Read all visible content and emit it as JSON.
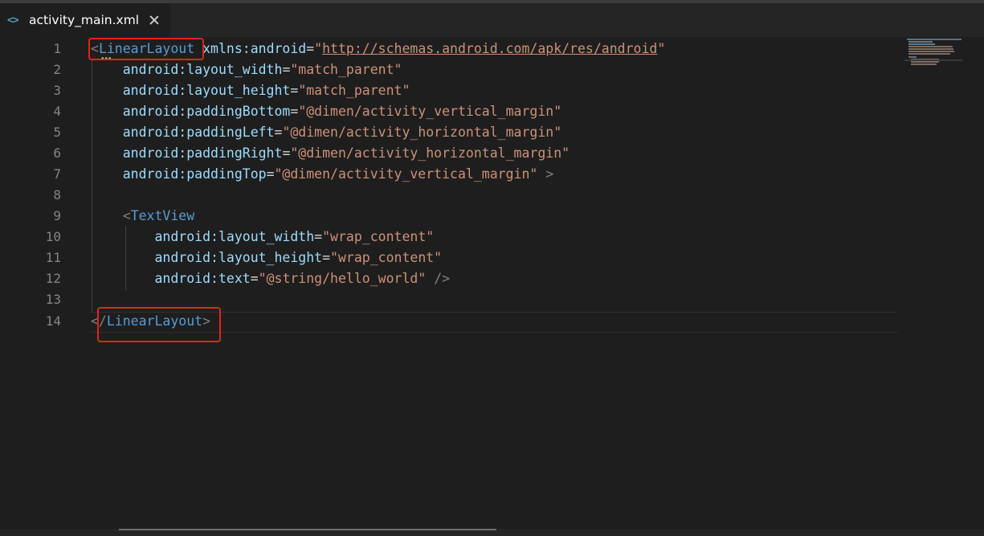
{
  "tab": {
    "icon": "<>",
    "icon_name": "xml-file-icon",
    "title": "activity_main.xml",
    "close_icon": "close-icon"
  },
  "line_numbers": [
    "1",
    "2",
    "3",
    "4",
    "5",
    "6",
    "7",
    "8",
    "9",
    "10",
    "11",
    "12",
    "13",
    "14"
  ],
  "code": {
    "l1": {
      "lt": "<",
      "tag": "LinearLayout",
      "attr": "xmlns:android",
      "eq": "=",
      "q1": "\"",
      "val": "http://schemas.android.com/apk/res/android",
      "q2": "\""
    },
    "l2": {
      "attr": "android:layout_width",
      "eq": "=",
      "val": "\"match_parent\""
    },
    "l3": {
      "attr": "android:layout_height",
      "eq": "=",
      "val": "\"match_parent\""
    },
    "l4": {
      "attr": "android:paddingBottom",
      "eq": "=",
      "val": "\"@dimen/activity_vertical_margin\""
    },
    "l5": {
      "attr": "android:paddingLeft",
      "eq": "=",
      "val": "\"@dimen/activity_horizontal_margin\""
    },
    "l6": {
      "attr": "android:paddingRight",
      "eq": "=",
      "val": "\"@dimen/activity_horizontal_margin\""
    },
    "l7": {
      "attr": "android:paddingTop",
      "eq": "=",
      "val": "\"@dimen/activity_vertical_margin\"",
      "end": " >"
    },
    "l9": {
      "lt": "<",
      "tag": "TextView"
    },
    "l10": {
      "attr": "android:layout_width",
      "eq": "=",
      "val": "\"wrap_content\""
    },
    "l11": {
      "attr": "android:layout_height",
      "eq": "=",
      "val": "\"wrap_content\""
    },
    "l12": {
      "attr": "android:text",
      "eq": "=",
      "val": "\"@string/hello_world\"",
      "end": " />"
    },
    "l14": {
      "lt": "</",
      "tag": "LinearLayout",
      "gt": ">"
    }
  },
  "colors": {
    "background": "#1e1e1e",
    "tag": "#569cd6",
    "attribute": "#9cdcfe",
    "string": "#ce9178",
    "punctuation": "#808080",
    "line_number": "#858585",
    "highlight_box": "#e0251b"
  }
}
